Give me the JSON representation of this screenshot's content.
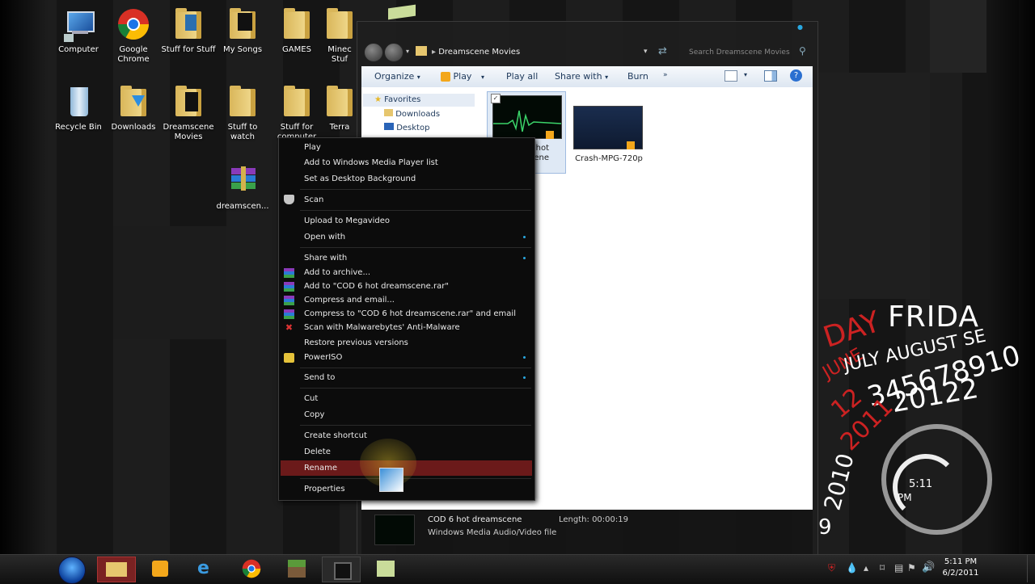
{
  "desktop_icons": [
    {
      "label": "Computer",
      "icon": "computer-icon"
    },
    {
      "label": "Google\nChrome",
      "icon": "chrome-icon"
    },
    {
      "label": "Stuff for Stuff",
      "icon": "folder-icon"
    },
    {
      "label": "My Songs",
      "icon": "folder-icon"
    },
    {
      "label": "GAMES",
      "icon": "folder-icon"
    },
    {
      "label": "Minec\nStuf",
      "icon": "folder-icon"
    },
    {
      "label": "Recycle Bin",
      "icon": "recycle-bin-icon"
    },
    {
      "label": "Downloads",
      "icon": "folder-download-icon"
    },
    {
      "label": "Dreamscene\nMovies",
      "icon": "folder-icon"
    },
    {
      "label": "Stuff to\nwatch",
      "icon": "folder-icon"
    },
    {
      "label": "Stuff for\ncomputer",
      "icon": "folder-icon"
    },
    {
      "label": "Terra",
      "icon": "folder-icon"
    },
    {
      "label": "dreamscen...",
      "icon": "winrar-archive-icon"
    }
  ],
  "explorer": {
    "address": "Dreamscene Movies",
    "search_placeholder": "Search Dreamscene Movies",
    "toolbar": {
      "organize": "Organize",
      "play": "Play",
      "play_all": "Play all",
      "share_with": "Share with",
      "burn": "Burn",
      "more": "»"
    },
    "nav": [
      {
        "label": "Favorites"
      },
      {
        "label": "Downloads"
      },
      {
        "label": "Desktop"
      }
    ],
    "files": [
      {
        "label": "hot\nene"
      },
      {
        "label": "Crash-MPG-720p"
      }
    ],
    "status": {
      "name": "COD 6 hot dreamscene",
      "type": "Windows Media Audio/Video file",
      "length_label": "Length:",
      "length": "00:00:19"
    }
  },
  "context_menu": {
    "items": {
      "play": "Play",
      "add_wmp": "Add to Windows Media Player list",
      "set_bg": "Set as Desktop Background",
      "scan": "Scan",
      "upload": "Upload to Megavideo",
      "open_with": "Open with",
      "share_with": "Share with",
      "add_archive": "Add to archive...",
      "add_rar": "Add to \"COD 6 hot dreamscene.rar\"",
      "compress_email": "Compress and email...",
      "compress_rar_email": "Compress to \"COD 6 hot dreamscene.rar\" and email",
      "malwarebytes": "Scan with Malwarebytes' Anti-Malware",
      "restore": "Restore previous versions",
      "poweriso": "PowerISO",
      "send_to": "Send to",
      "cut": "Cut",
      "copy": "Copy",
      "create_shortcut": "Create shortcut",
      "delete": "Delete",
      "rename": "Rename",
      "properties": "Properties"
    }
  },
  "calendar_widget": {
    "day_red": "DAY",
    "day_white": "FRIDA",
    "month_red": "JUNE",
    "months": "JULY AUGUST SE",
    "days_red": "12",
    "days_white": "345678910",
    "years_red": "2011",
    "years_white": "20122",
    "year_left": "2010",
    "year_far": "9",
    "clock_time": "5:11",
    "clock_ampm": "PM"
  },
  "taskbar": {
    "time": "5:11 PM",
    "date": "6/2/2011"
  }
}
